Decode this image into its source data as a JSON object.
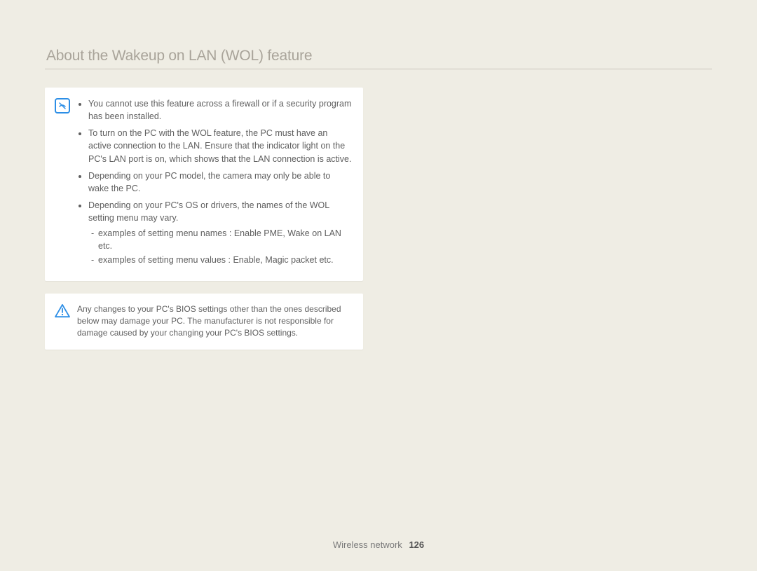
{
  "title": "About the Wakeup on LAN (WOL) feature",
  "info": {
    "bullets": [
      "You cannot use this feature across a firewall or if a security program has been installed.",
      "To turn on the PC with the WOL feature, the PC must have an active connection to the LAN. Ensure that the indicator light on the PC's LAN port is on, which shows that the LAN connection is active.",
      "Depending on your PC model, the camera may only be able to wake the PC.",
      "Depending on your PC's OS or drivers, the names of the WOL setting menu may vary."
    ],
    "sub_bullets": [
      "examples of setting menu names : Enable PME, Wake on LAN etc.",
      "examples of setting menu values : Enable, Magic packet etc."
    ]
  },
  "warning": {
    "text": "Any changes to your PC's BIOS settings other than the ones described below may damage your PC. The manufacturer is not responsible for damage caused by your changing your PC's BIOS settings."
  },
  "footer": {
    "section": "Wireless network",
    "page": "126"
  }
}
